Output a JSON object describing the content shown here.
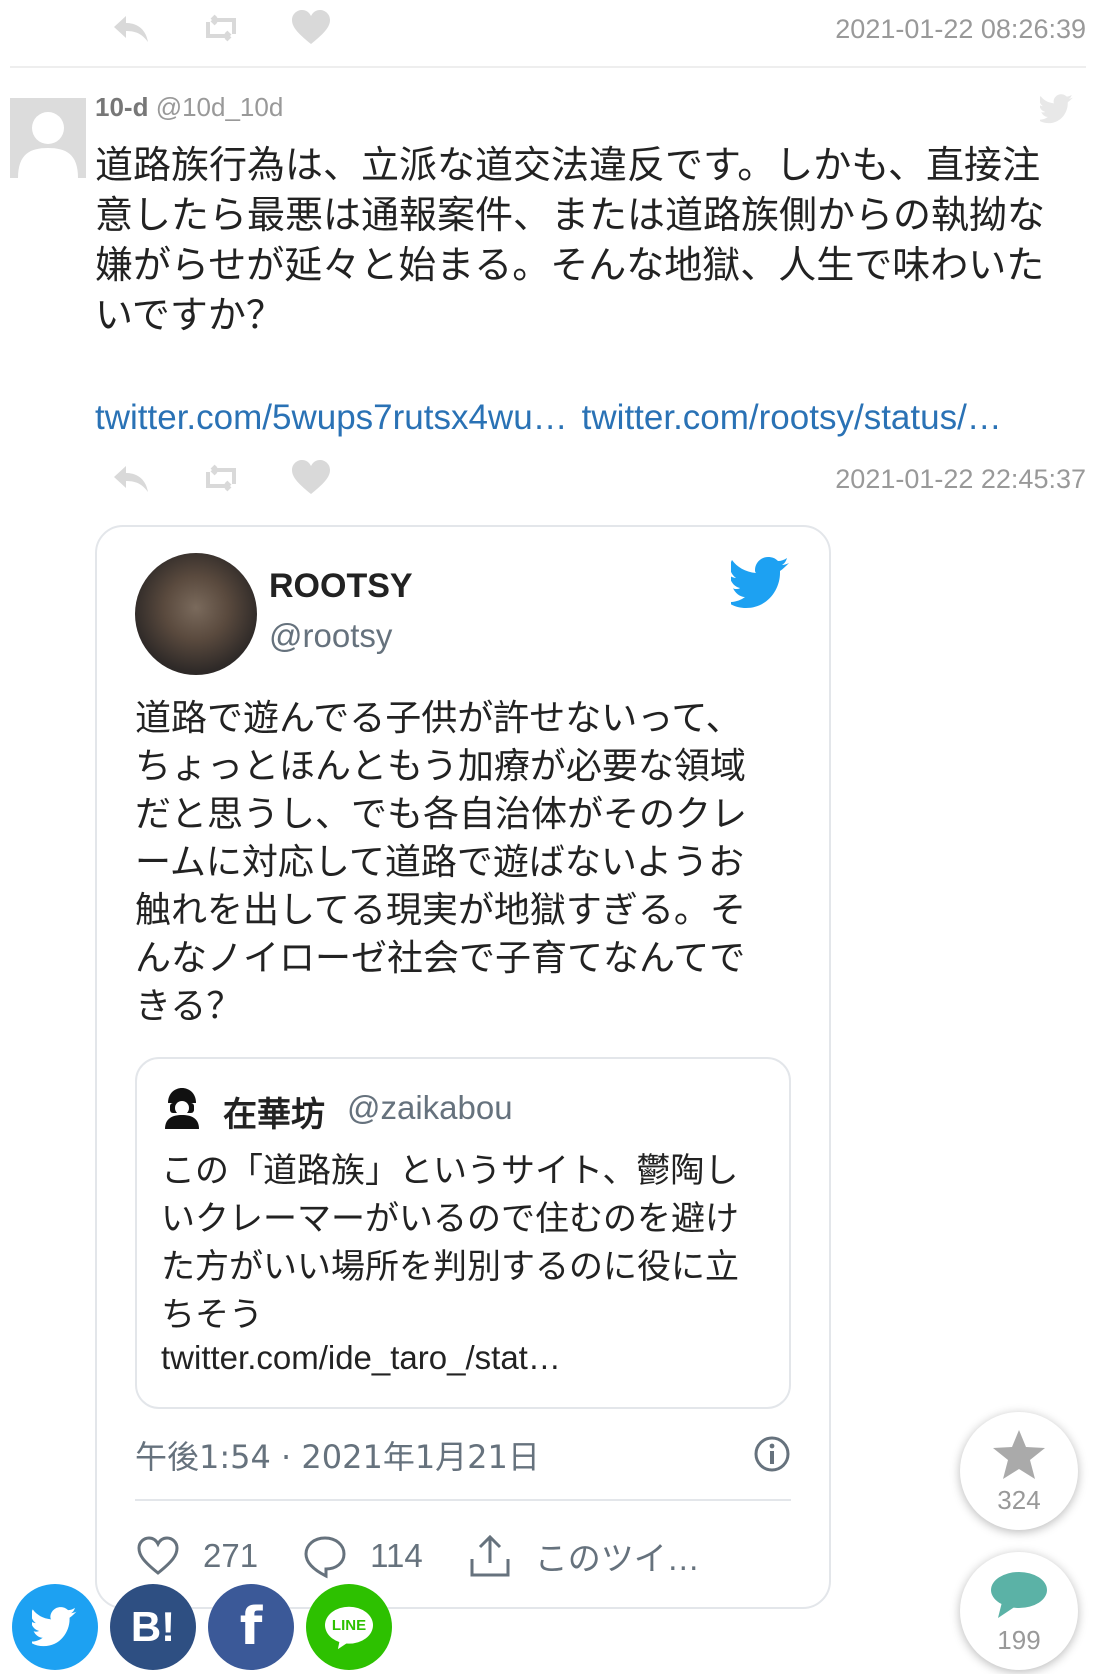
{
  "top_timestamp": "2021-01-22 08:26:39",
  "post": {
    "display_name": "10-d",
    "handle": "@10d_10d",
    "text": "道路族行為は、立派な道交法違反です。しかも、直接注意したら最悪は通報案件、または道路族側からの執拗な嫌がらせが延々と始まる。そんな地獄、人生で味わいたいですか？",
    "links": [
      "twitter.com/5wups7rutsx4wu…",
      "twitter.com/rootsy/status/…"
    ],
    "timestamp": "2021-01-22 22:45:37"
  },
  "embed": {
    "name": "ROOTSY",
    "handle": "@rootsy",
    "text": "道路で遊んでる子供が許せないって、ちょっとほんともう加療が必要な領域だと思うし、でも各自治体がそのクレームに対応して道路で遊ばないようお触れを出してる現実が地獄すぎる。そんなノイローゼ社会で子育てなんてできる？",
    "quote": {
      "name": "在華坊",
      "handle": "@zaikabou",
      "text": "この「道路族」というサイト、鬱陶しいクレーマーがいるので住むのを避けた方がいい場所を判別するのに役に立ちそう",
      "link": "twitter.com/ide_taro_/stat…"
    },
    "date": "午後1:54 · 2021年1月21日",
    "likes": "271",
    "replies": "114",
    "share_label": "このツイ…"
  },
  "fab": {
    "star_count": "324",
    "comment_count": "199"
  },
  "sns": {
    "hatena_label": "B!",
    "facebook_label": "f",
    "line_label": "LINE"
  },
  "colors": {
    "link": "#2a72b5",
    "twitter_blue": "#1da1f2",
    "hatena": "#2e4f82",
    "facebook": "#3b5998",
    "line": "#2dc100",
    "teal": "#5bb2a6"
  }
}
